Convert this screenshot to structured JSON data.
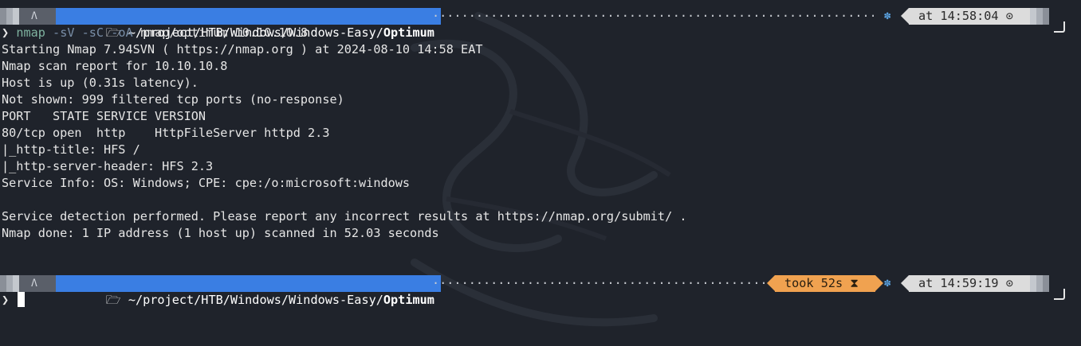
{
  "prompt1": {
    "os_glyph": "Λ",
    "folder_icon": "folder-icon",
    "dir_path": "~/project/HTB/Windows/Windows-Easy/",
    "dir_current": "Optimum",
    "time_label": "at 14:58:04",
    "clock_icon": "clock-icon",
    "gear_icon": "gear-icon"
  },
  "command": {
    "chevron": "❯",
    "name": "nmap",
    "args": "-sV -sC -oA",
    "rest": "nmap/optimum 10.10.10.8"
  },
  "output": [
    "Starting Nmap 7.94SVN ( https://nmap.org ) at 2024-08-10 14:58 EAT",
    "Nmap scan report for 10.10.10.8",
    "Host is up (0.31s latency).",
    "Not shown: 999 filtered tcp ports (no-response)",
    "PORT   STATE SERVICE VERSION",
    "80/tcp open  http    HttpFileServer httpd 2.3",
    "|_http-title: HFS /",
    "|_http-server-header: HFS 2.3",
    "Service Info: OS: Windows; CPE: cpe:/o:microsoft:windows",
    "",
    "Service detection performed. Please report any incorrect results at https://nmap.org/submit/ .",
    "Nmap done: 1 IP address (1 host up) scanned in 52.03 seconds"
  ],
  "prompt2": {
    "os_glyph": "Λ",
    "dir_path": "~/project/HTB/Windows/Windows-Easy/",
    "dir_current": "Optimum",
    "took_label": "took 52s",
    "hourglass_icon": "hourglass-icon",
    "time_label": "at 14:59:19",
    "chevron": "❯"
  },
  "colors": {
    "background": "#1f232b",
    "dir_segment": "#3a7ee3",
    "time_segment": "#dcdcdc",
    "took_segment": "#f0a250",
    "gear": "#5aa2e0"
  }
}
